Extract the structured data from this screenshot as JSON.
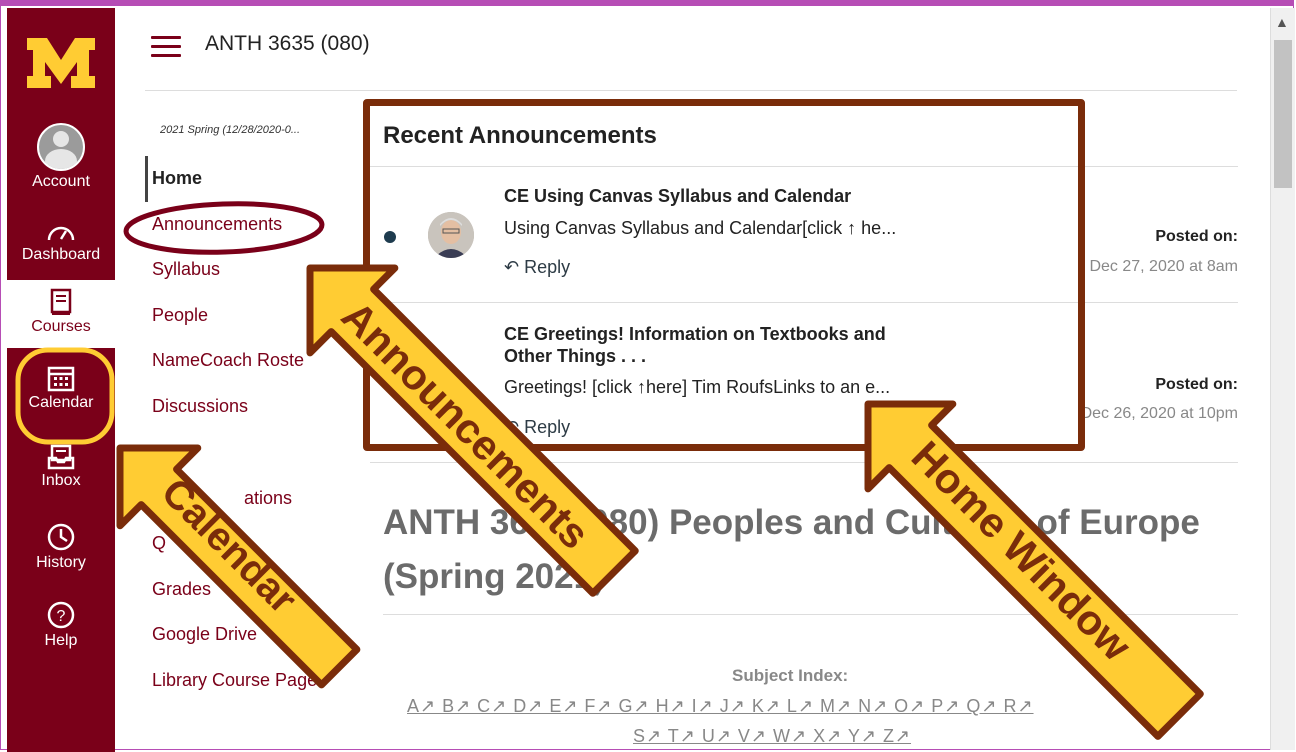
{
  "global_nav": {
    "logo_letter": "M",
    "items": [
      {
        "label": "Account",
        "icon": "avatar-icon"
      },
      {
        "label": "Dashboard",
        "icon": "dashboard-icon"
      },
      {
        "label": "Courses",
        "icon": "courses-icon"
      },
      {
        "label": "Calendar",
        "icon": "calendar-icon"
      },
      {
        "label": "Inbox",
        "icon": "inbox-icon"
      },
      {
        "label": "History",
        "icon": "history-icon"
      },
      {
        "label": "Help",
        "icon": "help-icon"
      }
    ]
  },
  "header": {
    "course_title": "ANTH 3635 (080)"
  },
  "course_nav": {
    "term": "2021 Spring (12/28/2020-0...",
    "items": [
      "Home",
      "Announcements",
      "Syllabus",
      "People",
      "NameCoach Roste",
      "Discussions",
      "ations",
      "Q",
      "Grades",
      "Google Drive",
      "Library Course Page"
    ]
  },
  "announcements": {
    "heading": "Recent Announcements",
    "items": [
      {
        "title": "CE Using Canvas Syllabus and Calendar",
        "snippet": "Using Canvas Syllabus and Calendar[click ↑ he...",
        "reply": "Reply",
        "posted_label": "Posted on:",
        "posted_date": "Dec 27, 2020 at 8am"
      },
      {
        "title_line1": "CE Greetings! Information on Textbooks and",
        "title_line2": "Other Things . . .",
        "snippet": "Greetings! [click ↑here] Tim RoufsLinks to an e...",
        "reply": "Reply",
        "posted_label": "Posted on:",
        "posted_date": "Dec 26, 2020 at 10pm"
      }
    ]
  },
  "page": {
    "heading_line1": "ANTH 3635 (080) Peoples and Cultures of Europe",
    "heading_line2": "(Spring 2021)",
    "subject_index_label": "Subject Index:",
    "letters_row1": "A↗ B↗ C↗ D↗ E↗ F↗ G↗ H↗ I↗ J↗ K↗ L↗ M↗ N↗ O↗ P↗ Q↗ R↗",
    "letters_row2": "S↗ T↗ U↗ V↗ W↗ X↗ Y↗ Z↗"
  },
  "annotations": {
    "calendar": "Calendar",
    "announcements": "Announcements",
    "home_window": "Home Window",
    "accent_color": "#ffcc33",
    "outline_color": "#7a2c0a"
  }
}
